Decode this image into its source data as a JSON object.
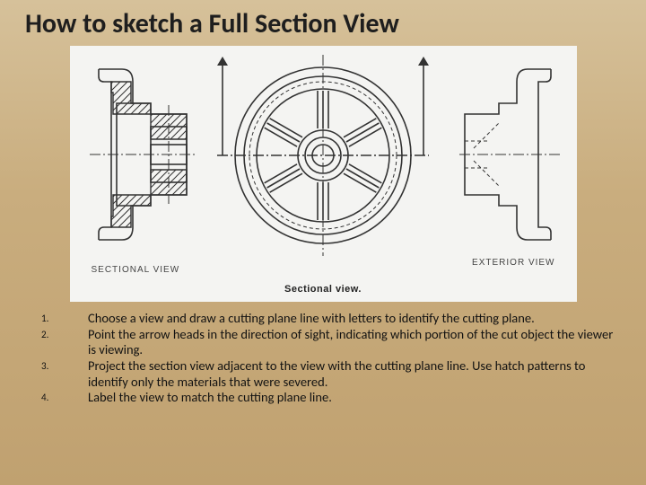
{
  "title": "How to sketch a Full Section View",
  "figure": {
    "sectional_label": "SECTIONAL VIEW",
    "exterior_label": "EXTERIOR VIEW",
    "caption": "Sectional view."
  },
  "steps": [
    "Choose a view and draw a cutting plane line with letters to identify the cutting plane.",
    "Point the arrow heads in the direction of sight, indicating which portion of the cut object the viewer is viewing.",
    "Project the section view adjacent to the view with the cutting plane line.  Use hatch patterns to identify only the materials that were severed.",
    "Label the view to match the cutting plane line."
  ]
}
